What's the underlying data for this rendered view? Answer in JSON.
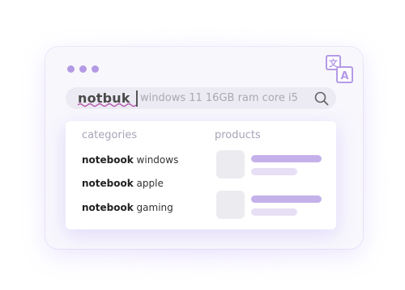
{
  "window": {
    "dots": [
      "",
      "",
      ""
    ],
    "translate_icon": "translate-icon"
  },
  "search": {
    "typed": "notbuk",
    "suggestion": "windows 11 16GB ram core i5",
    "icon": "search-icon",
    "misspelled": true
  },
  "dropdown": {
    "categories_header": "categories",
    "products_header": "products",
    "categories": [
      {
        "bold": "notebook",
        "rest": " windows"
      },
      {
        "bold": "notebook",
        "rest": " apple"
      },
      {
        "bold": "notebook",
        "rest": " gaming"
      }
    ],
    "products": [
      {
        "placeholder": true
      },
      {
        "placeholder": true
      }
    ]
  },
  "colors": {
    "accent": "#b49ae6",
    "bar": "#c4b1ea",
    "bar_light": "#e6dff5",
    "squiggle": "#b85ab0"
  }
}
